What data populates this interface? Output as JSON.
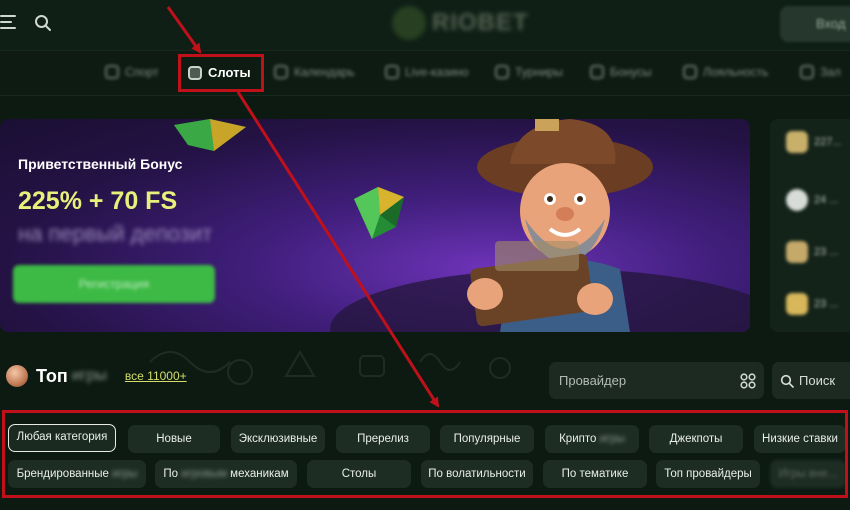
{
  "header": {
    "logo_text": "RIOBET",
    "login_label": "Вход"
  },
  "nav": {
    "items": [
      {
        "label": "Спорт"
      },
      {
        "label": "Слоты"
      },
      {
        "label": "Календарь"
      },
      {
        "label": "Live-казино"
      },
      {
        "label": "Турниры"
      },
      {
        "label": "Бонусы"
      },
      {
        "label": "Лояльность"
      },
      {
        "label": "Зал"
      }
    ]
  },
  "banner": {
    "title": "Приветственный Бонус",
    "amount": "225% + 70 FS",
    "subtitle": "на первый депозит",
    "button_label": "Регистрация"
  },
  "side_panel": {
    "rows": [
      {
        "value": "227..."
      },
      {
        "value": "24 ..."
      },
      {
        "value": "23 ..."
      },
      {
        "value": "23 ..."
      }
    ]
  },
  "games": {
    "heading": "Топ",
    "heading_hidden": "игры",
    "all_link": "все 11000+",
    "provider_placeholder": "Провайдер",
    "search_label": "Поиск"
  },
  "chips": {
    "row1": [
      {
        "label": "Любая категория"
      },
      {
        "label": "Новые"
      },
      {
        "label": "Эксклюзивные"
      },
      {
        "label": "Пререлиз"
      },
      {
        "label": "Популярные"
      },
      {
        "label": "Крипто",
        "hidden": "игры"
      },
      {
        "label": "Джекпоты"
      },
      {
        "label": "Низкие ставки"
      }
    ],
    "row2": [
      {
        "label": "Брендированные",
        "hidden": "игры"
      },
      {
        "label": "По",
        "hidden": "игровым",
        "label2": "механикам"
      },
      {
        "label": "Столы"
      },
      {
        "label": "По волатильности"
      },
      {
        "label": "По тематике"
      },
      {
        "label": "Топ провайдеры"
      },
      {
        "label": "Игры вне..."
      }
    ]
  },
  "colors": {
    "background": "#0c1a12",
    "accent_green": "#3dba45",
    "bonus_yellow": "#e6f07a",
    "annotation_red": "#c0111b"
  }
}
